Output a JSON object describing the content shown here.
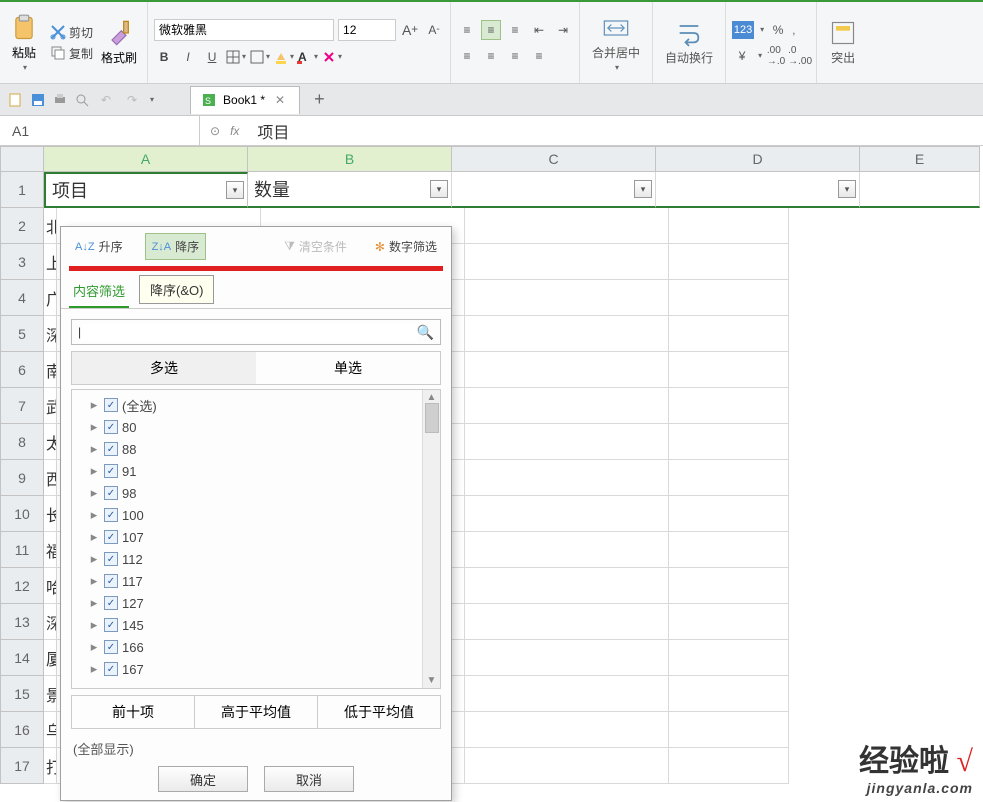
{
  "ribbon": {
    "paste_label": "粘贴",
    "cut_label": "剪切",
    "copy_label": "复制",
    "format_painter_label": "格式刷",
    "font_name": "微软雅黑",
    "font_size": "12",
    "bold": "B",
    "italic": "I",
    "underline": "U",
    "merge_label": "合并居中",
    "wrap_label": "自动换行",
    "highlight_label": "突出",
    "currency_sym": "¥",
    "percent_sym": "%"
  },
  "qat": {
    "file_tab": "Book1 *"
  },
  "formula_bar": {
    "name_box": "A1",
    "fx_label": "fx",
    "value": "项目"
  },
  "sheet": {
    "cols": [
      "A",
      "B",
      "C",
      "D",
      "E"
    ],
    "headers": {
      "A": "项目",
      "B": "数量",
      "C": "",
      "D": "",
      "E": ""
    },
    "rows_visible": [
      "1",
      "2",
      "3",
      "4",
      "5",
      "6",
      "7",
      "8",
      "9",
      "10",
      "11",
      "12",
      "13",
      "14",
      "15",
      "16",
      "17"
    ],
    "colA_peek": [
      "",
      "北",
      "上",
      "广",
      "深",
      "南",
      "武",
      "太",
      "西",
      "长",
      "福",
      "哈",
      "深",
      "厦",
      "景",
      "乌",
      "打"
    ]
  },
  "filter": {
    "asc_label": "升序",
    "desc_label": "降序",
    "clear_label": "清空条件",
    "num_filter_label": "数字筛选",
    "tab_content": "内容筛选",
    "tooltip_text": "降序(&O)",
    "mode_multi": "多选",
    "mode_single": "单选",
    "select_all": "(全选)",
    "items": [
      "80",
      "88",
      "91",
      "98",
      "100",
      "107",
      "112",
      "117",
      "127",
      "145",
      "166",
      "167"
    ],
    "top10": "前十项",
    "above_avg": "高于平均值",
    "below_avg": "低于平均值",
    "show_all": "(全部显示)",
    "ok": "确定",
    "cancel": "取消",
    "search_placeholder": ""
  },
  "watermark": {
    "line1a": "经验啦",
    "line1b": "√",
    "line2": "jingyanla.com"
  }
}
